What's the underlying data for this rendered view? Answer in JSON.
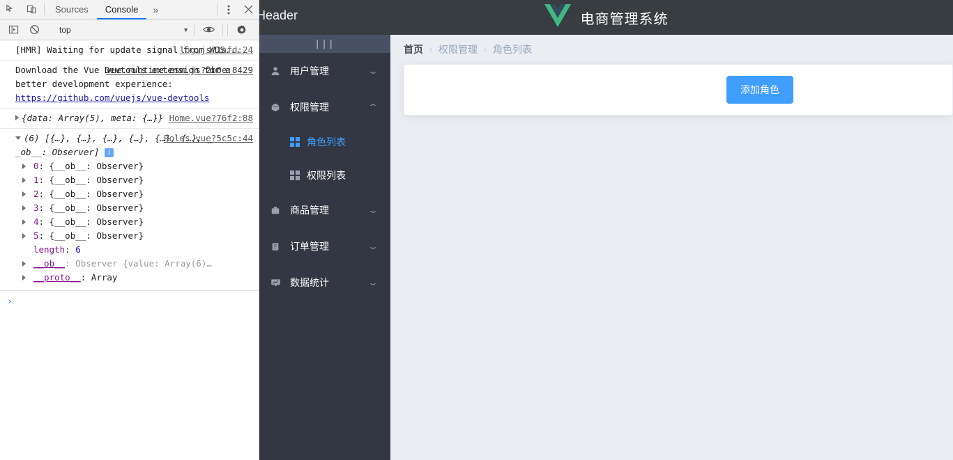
{
  "devtools": {
    "tabs": [
      {
        "label": "Sources",
        "active": false
      },
      {
        "label": "Console",
        "active": true
      }
    ],
    "more_tabs_icon": "chevron-double-right-icon",
    "inspect_icon": "inspect-element-icon",
    "device_icon": "device-toolbar-icon",
    "menu_icon": "kebab-menu-icon",
    "close_icon": "close-icon",
    "toolbar": {
      "sidebar_icon": "console-sidebar-icon",
      "clear_icon": "clear-console-icon",
      "context_value": "top",
      "context_caret": "chevron-down-icon",
      "eye_icon": "live-expression-eye-icon",
      "gear_icon": "gear-icon"
    },
    "logs": [
      {
        "source": "log.js?1afd:24",
        "text": "[HMR] Waiting for update signal from WDS..."
      },
      {
        "source": "vue.runtime.esm.js?2b0e:8429",
        "text_before": "Download ",
        "text_after": "the Vue Devtools extension for a better development experience:",
        "link": "https://github.com/vuejs/vue-devtools"
      },
      {
        "source": "Home.vue?76f2:88",
        "text": "{data: Array(5), meta: {…}}"
      }
    ],
    "array_log": {
      "source": "Roles.vue?5c5c:44",
      "summary_line1": "(6) [{…}, {…}, {…}, {…}, {…}, {…}, _",
      "summary_line2": "_ob__: Observer]",
      "info_badge": "i",
      "rows": [
        {
          "key": "0",
          "value": "{__ob__: Observer}",
          "expandable": true
        },
        {
          "key": "1",
          "value": "{__ob__: Observer}",
          "expandable": true
        },
        {
          "key": "2",
          "value": "{__ob__: Observer}",
          "expandable": true
        },
        {
          "key": "3",
          "value": "{__ob__: Observer}",
          "expandable": true
        },
        {
          "key": "4",
          "value": "{__ob__: Observer}",
          "expandable": true
        },
        {
          "key": "5",
          "value": "{__ob__: Observer}",
          "expandable": true
        },
        {
          "key": "length",
          "value": "6",
          "expandable": false
        },
        {
          "key": "__ob__",
          "value": "Observer {value: Array(6)…",
          "expandable": true
        },
        {
          "key": "__proto__",
          "value": "Array",
          "expandable": true
        }
      ]
    },
    "prompt_symbol": "›"
  },
  "app": {
    "header": {
      "left_text": "Header",
      "logo_icon": "vue-logo-icon",
      "title": "电商管理系统"
    },
    "sidebar": {
      "toggle_glyph": "|||",
      "menu": [
        {
          "label": "用户管理",
          "icon": "user-icon",
          "icon_glyph": "👤",
          "arrow": "chevron-down-icon",
          "expanded": false,
          "children": []
        },
        {
          "label": "权限管理",
          "icon": "package-icon",
          "icon_glyph": "📦",
          "arrow": "chevron-up-icon",
          "expanded": true,
          "children": [
            {
              "label": "角色列表",
              "icon": "grid-icon",
              "active": true
            },
            {
              "label": "权限列表",
              "icon": "grid-icon",
              "active": false
            }
          ]
        },
        {
          "label": "商品管理",
          "icon": "briefcase-icon",
          "icon_glyph": "🗄",
          "arrow": "chevron-down-icon",
          "expanded": false,
          "children": []
        },
        {
          "label": "订单管理",
          "icon": "clipboard-icon",
          "icon_glyph": "📋",
          "arrow": "chevron-down-icon",
          "expanded": false,
          "children": []
        },
        {
          "label": "数据统计",
          "icon": "chart-icon",
          "icon_glyph": "📈",
          "arrow": "chevron-down-icon",
          "expanded": false,
          "children": []
        }
      ]
    },
    "breadcrumb": [
      {
        "label": "首页"
      },
      {
        "label": "权限管理"
      },
      {
        "label": "角色列表"
      }
    ],
    "breadcrumb_separator": "›",
    "card": {
      "add_button_label": "添加角色"
    }
  },
  "colors": {
    "accent": "#409EFF",
    "header_bg": "#373D41",
    "sidebar_bg": "#333744",
    "content_bg": "#EAEDF1",
    "vue_green": "#41B883",
    "vue_dark": "#35495E"
  }
}
